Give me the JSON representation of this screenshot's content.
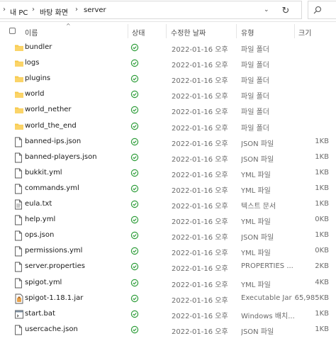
{
  "address": {
    "segments": [
      "내 PC",
      "바탕 화면",
      "server"
    ]
  },
  "columns": {
    "name": "이름",
    "status": "상태",
    "date": "수정한 날짜",
    "type": "유형",
    "size": "크기"
  },
  "files": [
    {
      "name": "bundler",
      "date": "2022-01-16 오후",
      "type": "파일 폴더",
      "size": "",
      "icon": "folder"
    },
    {
      "name": "logs",
      "date": "2022-01-16 오후",
      "type": "파일 폴더",
      "size": "",
      "icon": "folder"
    },
    {
      "name": "plugins",
      "date": "2022-01-16 오후",
      "type": "파일 폴더",
      "size": "",
      "icon": "folder"
    },
    {
      "name": "world",
      "date": "2022-01-16 오후",
      "type": "파일 폴더",
      "size": "",
      "icon": "folder"
    },
    {
      "name": "world_nether",
      "date": "2022-01-16 오후",
      "type": "파일 폴더",
      "size": "",
      "icon": "folder"
    },
    {
      "name": "world_the_end",
      "date": "2022-01-16 오후",
      "type": "파일 폴더",
      "size": "",
      "icon": "folder"
    },
    {
      "name": "banned-ips.json",
      "date": "2022-01-16 오후",
      "type": "JSON 파일",
      "size": "1KB",
      "icon": "file"
    },
    {
      "name": "banned-players.json",
      "date": "2022-01-16 오후",
      "type": "JSON 파일",
      "size": "1KB",
      "icon": "file"
    },
    {
      "name": "bukkit.yml",
      "date": "2022-01-16 오후",
      "type": "YML 파일",
      "size": "1KB",
      "icon": "file"
    },
    {
      "name": "commands.yml",
      "date": "2022-01-16 오후",
      "type": "YML 파일",
      "size": "1KB",
      "icon": "file"
    },
    {
      "name": "eula.txt",
      "date": "2022-01-16 오후",
      "type": "텍스트 문서",
      "size": "1KB",
      "icon": "text"
    },
    {
      "name": "help.yml",
      "date": "2022-01-16 오후",
      "type": "YML 파일",
      "size": "0KB",
      "icon": "file"
    },
    {
      "name": "ops.json",
      "date": "2022-01-16 오후",
      "type": "JSON 파일",
      "size": "1KB",
      "icon": "file"
    },
    {
      "name": "permissions.yml",
      "date": "2022-01-16 오후",
      "type": "YML 파일",
      "size": "0KB",
      "icon": "file"
    },
    {
      "name": "server.properties",
      "date": "2022-01-16 오후",
      "type": "PROPERTIES ...",
      "size": "2KB",
      "icon": "file"
    },
    {
      "name": "spigot.yml",
      "date": "2022-01-16 오후",
      "type": "YML 파일",
      "size": "4KB",
      "icon": "file"
    },
    {
      "name": "spigot-1.18.1.jar",
      "date": "2022-01-16 오후",
      "type": "Executable Jar ...",
      "size": "65,985KB",
      "icon": "jar"
    },
    {
      "name": "start.bat",
      "date": "2022-01-16 오후",
      "type": "Windows 배치...",
      "size": "1KB",
      "icon": "bat"
    },
    {
      "name": "usercache.json",
      "date": "2022-01-16 오후",
      "type": "JSON 파일",
      "size": "1KB",
      "icon": "file"
    }
  ],
  "colors": {
    "folder": "#f7c948",
    "status_ok": "#2e9d3a",
    "accent": "#0078d4"
  }
}
